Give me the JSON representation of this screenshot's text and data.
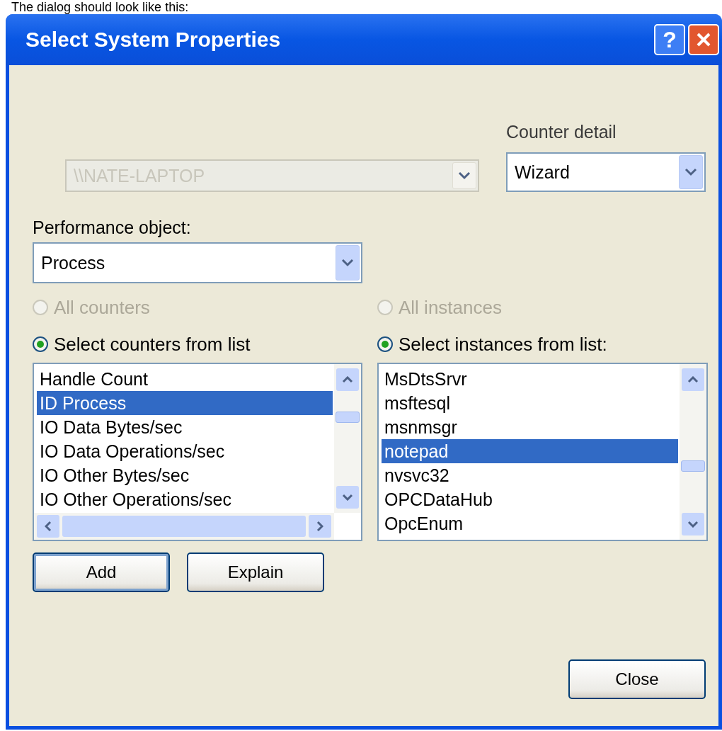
{
  "caption": "The dialog should look like this:",
  "window": {
    "title": "Select System Properties"
  },
  "title_buttons": [
    {
      "kind": "help",
      "label": "?"
    },
    {
      "kind": "close"
    }
  ],
  "machine": {
    "value": "\\\\NATE-LAPTOP",
    "disabled": true
  },
  "counter_detail": {
    "label": "Counter detail",
    "value": "Wizard"
  },
  "performance_object": {
    "label": "Performance object:",
    "value": "Process"
  },
  "counters": {
    "radios": [
      {
        "label": "All counters",
        "selected": false,
        "disabled": true
      },
      {
        "label": "Select counters from list",
        "selected": true,
        "disabled": false
      }
    ],
    "items": [
      {
        "label": "Handle Count",
        "selected": false
      },
      {
        "label": "ID Process",
        "selected": true
      },
      {
        "label": "IO Data Bytes/sec",
        "selected": false
      },
      {
        "label": "IO Data Operations/sec",
        "selected": false
      },
      {
        "label": "IO Other Bytes/sec",
        "selected": false
      },
      {
        "label": "IO Other Operations/sec",
        "selected": false
      }
    ]
  },
  "instances": {
    "radios": [
      {
        "label": "All instances",
        "selected": false,
        "disabled": true
      },
      {
        "label": "Select instances from list:",
        "selected": true,
        "disabled": false
      }
    ],
    "items": [
      {
        "label": "MsDtsSrvr",
        "selected": false
      },
      {
        "label": "msftesql",
        "selected": false
      },
      {
        "label": "msnmsgr",
        "selected": false
      },
      {
        "label": "notepad",
        "selected": true
      },
      {
        "label": "nvsvc32",
        "selected": false
      },
      {
        "label": "OPCDataHub",
        "selected": false
      },
      {
        "label": "OpcEnum",
        "selected": false
      }
    ]
  },
  "buttons": [
    {
      "label": "Add",
      "default": true
    },
    {
      "label": "Explain",
      "default": false
    }
  ],
  "close_button": {
    "label": "Close"
  }
}
